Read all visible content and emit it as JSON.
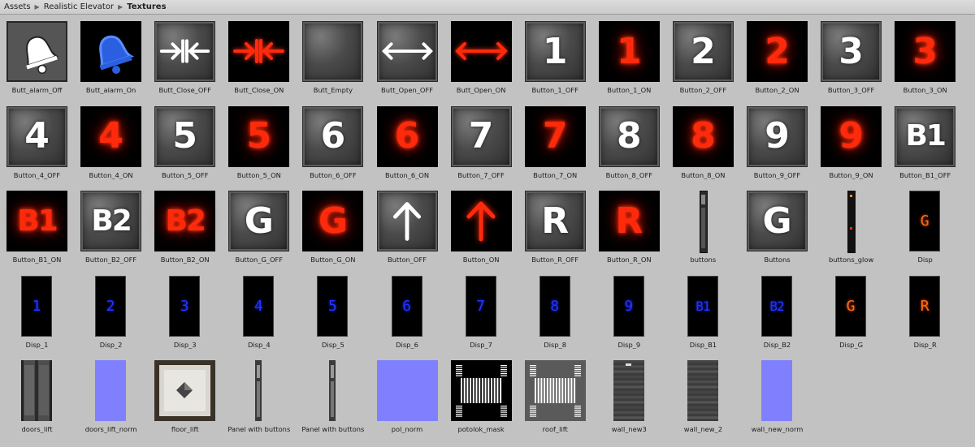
{
  "breadcrumb": {
    "items": [
      "Assets",
      "Realistic Elevator",
      "Textures"
    ]
  },
  "colors": {
    "background": "#c2c2c2",
    "glow_red": "#ff2a0c",
    "display_blue": "#2233ff",
    "display_orange": "#ff6a10",
    "normal_map": "#8080ff"
  },
  "assets": [
    {
      "label": "Butt_alarm_Off",
      "kind": "icon",
      "icon": "bell-outline-icon"
    },
    {
      "label": "Butt_alarm_On",
      "kind": "icon",
      "icon": "bell-blue-icon"
    },
    {
      "label": "Butt_Close_OFF",
      "kind": "icon",
      "icon": "close-arrows-white-icon"
    },
    {
      "label": "Butt_Close_ON",
      "kind": "icon",
      "icon": "close-arrows-red-icon"
    },
    {
      "label": "Butt_Empty",
      "kind": "icon",
      "icon": "empty-button-icon"
    },
    {
      "label": "Butt_Open_OFF",
      "kind": "icon",
      "icon": "open-arrows-white-icon"
    },
    {
      "label": "Butt_Open_ON",
      "kind": "icon",
      "icon": "open-arrows-red-icon"
    },
    {
      "label": "Button_1_OFF",
      "kind": "off",
      "glyph": "1"
    },
    {
      "label": "Button_1_ON",
      "kind": "on",
      "glyph": "1"
    },
    {
      "label": "Button_2_OFF",
      "kind": "off",
      "glyph": "2"
    },
    {
      "label": "Button_2_ON",
      "kind": "on",
      "glyph": "2"
    },
    {
      "label": "Button_3_OFF",
      "kind": "off",
      "glyph": "3"
    },
    {
      "label": "Button_3_ON",
      "kind": "on",
      "glyph": "3"
    },
    {
      "label": "Button_4_OFF",
      "kind": "off",
      "glyph": "4"
    },
    {
      "label": "Button_4_ON",
      "kind": "on",
      "glyph": "4"
    },
    {
      "label": "Button_5_OFF",
      "kind": "off",
      "glyph": "5"
    },
    {
      "label": "Button_5_ON",
      "kind": "on",
      "glyph": "5"
    },
    {
      "label": "Button_6_OFF",
      "kind": "off",
      "glyph": "6"
    },
    {
      "label": "Button_6_ON",
      "kind": "on",
      "glyph": "6"
    },
    {
      "label": "Button_7_OFF",
      "kind": "off",
      "glyph": "7"
    },
    {
      "label": "Button_7_ON",
      "kind": "on",
      "glyph": "7"
    },
    {
      "label": "Button_8_OFF",
      "kind": "off",
      "glyph": "8"
    },
    {
      "label": "Button_8_ON",
      "kind": "on",
      "glyph": "8"
    },
    {
      "label": "Button_9_OFF",
      "kind": "off",
      "glyph": "9"
    },
    {
      "label": "Button_9_ON",
      "kind": "on",
      "glyph": "9"
    },
    {
      "label": "Button_B1_OFF",
      "kind": "off",
      "glyph": "B1"
    },
    {
      "label": "Button_B1_ON",
      "kind": "on",
      "glyph": "B1"
    },
    {
      "label": "Button_B2_OFF",
      "kind": "off",
      "glyph": "B2"
    },
    {
      "label": "Button_B2_ON",
      "kind": "on",
      "glyph": "B2"
    },
    {
      "label": "Button_G_OFF",
      "kind": "off",
      "glyph": "G"
    },
    {
      "label": "Button_G_ON",
      "kind": "on",
      "glyph": "G"
    },
    {
      "label": "Button_OFF",
      "kind": "icon",
      "icon": "arrow-up-white-icon"
    },
    {
      "label": "Button_ON",
      "kind": "icon",
      "icon": "arrow-up-red-icon"
    },
    {
      "label": "Button_R_OFF",
      "kind": "off",
      "glyph": "R"
    },
    {
      "label": "Button_R_ON",
      "kind": "on",
      "glyph": "R"
    },
    {
      "label": "buttons",
      "kind": "strip",
      "icon": "button-strip-icon"
    },
    {
      "label": "Buttons",
      "kind": "off",
      "glyph": "G"
    },
    {
      "label": "buttons_glow",
      "kind": "strip",
      "icon": "button-glow-strip-icon"
    },
    {
      "label": "Disp",
      "kind": "disp",
      "glyph": "G",
      "tone": "orange"
    },
    {
      "label": "Disp_1",
      "kind": "disp",
      "glyph": "1",
      "tone": "blue"
    },
    {
      "label": "Disp_2",
      "kind": "disp",
      "glyph": "2",
      "tone": "blue"
    },
    {
      "label": "Disp_3",
      "kind": "disp",
      "glyph": "3",
      "tone": "blue"
    },
    {
      "label": "Disp_4",
      "kind": "disp",
      "glyph": "4",
      "tone": "blue"
    },
    {
      "label": "Disp_5",
      "kind": "disp",
      "glyph": "5",
      "tone": "blue"
    },
    {
      "label": "Disp_6",
      "kind": "disp",
      "glyph": "6",
      "tone": "blue"
    },
    {
      "label": "Disp_7",
      "kind": "disp",
      "glyph": "7",
      "tone": "blue"
    },
    {
      "label": "Disp_8",
      "kind": "disp",
      "glyph": "8",
      "tone": "blue"
    },
    {
      "label": "Disp_9",
      "kind": "disp",
      "glyph": "9",
      "tone": "blue"
    },
    {
      "label": "Disp_B1",
      "kind": "disp",
      "glyph": "B1",
      "tone": "blue"
    },
    {
      "label": "Disp_B2",
      "kind": "disp",
      "glyph": "B2",
      "tone": "blue"
    },
    {
      "label": "Disp_G",
      "kind": "disp",
      "glyph": "G",
      "tone": "orange"
    },
    {
      "label": "Disp_R",
      "kind": "disp",
      "glyph": "R",
      "tone": "orange"
    },
    {
      "label": "doors_lift",
      "kind": "texture",
      "icon": "doors-texture-icon"
    },
    {
      "label": "doors_lift_norm",
      "kind": "texture",
      "icon": "normal-map-narrow-icon"
    },
    {
      "label": "floor_lift",
      "kind": "texture",
      "icon": "floor-texture-icon"
    },
    {
      "label": "Panel with buttons",
      "kind": "texture",
      "icon": "panel-strip-icon"
    },
    {
      "label": "Panel with buttons",
      "kind": "texture",
      "icon": "panel-strip-icon"
    },
    {
      "label": "pol_norm",
      "kind": "texture",
      "icon": "normal-map-icon"
    },
    {
      "label": "potolok_mask",
      "kind": "texture",
      "icon": "ceiling-mask-icon"
    },
    {
      "label": "roof_lift",
      "kind": "texture",
      "icon": "roof-texture-icon"
    },
    {
      "label": "wall_new3",
      "kind": "texture",
      "icon": "wall-texture-icon"
    },
    {
      "label": "wall_new_2",
      "kind": "texture",
      "icon": "wall-texture-2-icon"
    },
    {
      "label": "wall_new_norm",
      "kind": "texture",
      "icon": "normal-map-narrow-icon"
    }
  ]
}
